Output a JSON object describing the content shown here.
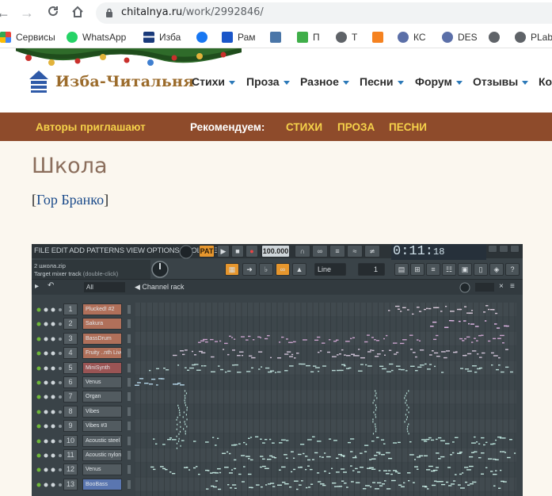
{
  "browser": {
    "url_host": "chitalnya.ru",
    "url_path": "/work/2992846/",
    "bookmarks": [
      {
        "label": "Сервисы",
        "icon": "apps-grid-icon",
        "color": "#e8453c"
      },
      {
        "label": "WhatsApp",
        "icon": "whatsapp-icon",
        "color": "#25d366"
      },
      {
        "label": "Изба",
        "icon": "izba-icon",
        "color": "#1a3a7a"
      },
      {
        "label": "",
        "icon": "facebook-icon",
        "color": "#1877f2"
      },
      {
        "label": "Рам",
        "icon": "slash-icon",
        "color": "#1a56c9"
      },
      {
        "label": "",
        "icon": "vk-icon",
        "color": "#4a76a8"
      },
      {
        "label": "П",
        "icon": "green-square-icon",
        "color": "#3fae49"
      },
      {
        "label": "Т",
        "icon": "globe-icon",
        "color": "#5f6368"
      },
      {
        "label": "",
        "icon": "odnoklassniki-icon",
        "color": "#f58220"
      },
      {
        "label": "КС",
        "icon": "shield-icon",
        "color": "#5b6fa8"
      },
      {
        "label": "DES",
        "icon": "shield-icon",
        "color": "#5b6fa8"
      },
      {
        "label": "",
        "icon": "globe-icon",
        "color": "#5f6368"
      },
      {
        "label": "PLab",
        "icon": "globe-icon",
        "color": "#5f6368"
      }
    ]
  },
  "site": {
    "logo_text": "Изба-Читальня",
    "menu": [
      "Стихи",
      "Проза",
      "Разное",
      "Песни",
      "Форум",
      "Отзывы",
      "Ко"
    ],
    "strip": {
      "authors": "Авторы приглашают",
      "recommend": "Рекомендуем:",
      "links": [
        "СТИХИ",
        "ПРОЗА",
        "ПЕСНИ"
      ]
    },
    "accent_color": "#8e4b2b",
    "strip_text_color": "#f6d24a"
  },
  "work": {
    "title": "Школа",
    "author": "Гор Бранко",
    "bracket_open": "[",
    "bracket_close": "]"
  },
  "fl": {
    "menubar": "FILE EDIT ADD PATTERNS VIEW OPTIONS TOOLS HELP",
    "pat": "PAT",
    "tempo": "100.000",
    "time_main": "0:11:",
    "time_sub": "18",
    "file_name": "2 школа.zip",
    "target": "Target mixer track",
    "double_click": "(double-click)",
    "mode": "Line",
    "step": "1",
    "filter": "All",
    "rack_title": "Channel rack",
    "channels": [
      {
        "num": "1",
        "name": "Plucked! #2",
        "color": "#b0705a"
      },
      {
        "num": "2",
        "name": "Sakura",
        "color": "#b0705a"
      },
      {
        "num": "3",
        "name": "BassDrum",
        "color": "#b0705a"
      },
      {
        "num": "4",
        "name": "Fruity ..nth Live",
        "color": "#b0705a"
      },
      {
        "num": "5",
        "name": "MiniSynth",
        "color": "#9a5454"
      },
      {
        "num": "6",
        "name": "Venus",
        "color": "#525b60"
      },
      {
        "num": "7",
        "name": "Organ",
        "color": "#525b60"
      },
      {
        "num": "8",
        "name": "Vibes",
        "color": "#525b60"
      },
      {
        "num": "9",
        "name": "Vibes #3",
        "color": "#525b60"
      },
      {
        "num": "10",
        "name": "Acoustic steel",
        "color": "#525b60"
      },
      {
        "num": "11",
        "name": "Acoustic nylon",
        "color": "#525b60"
      },
      {
        "num": "12",
        "name": "Venus",
        "color": "#525b60"
      },
      {
        "num": "13",
        "name": "BooBass",
        "color": "#5a76b0"
      }
    ]
  }
}
